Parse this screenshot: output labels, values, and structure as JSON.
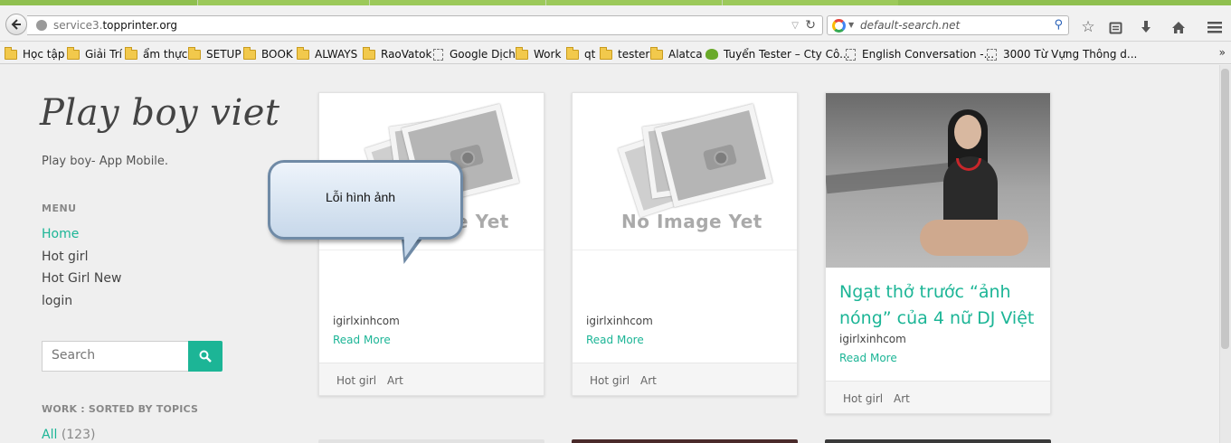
{
  "browser": {
    "url_prefix": "service3.",
    "url_domain": "topprinter.org",
    "search_placeholder": "default-search.net",
    "bookmarks": [
      {
        "label": "Học tập",
        "type": "folder"
      },
      {
        "label": "Giải Trí",
        "type": "folder"
      },
      {
        "label": "ẩm thực",
        "type": "folder"
      },
      {
        "label": "SETUP",
        "type": "folder"
      },
      {
        "label": "BOOK",
        "type": "folder"
      },
      {
        "label": "ALWAYS",
        "type": "folder"
      },
      {
        "label": "RaoVatok",
        "type": "folder"
      },
      {
        "label": "Google Dịch",
        "type": "page"
      },
      {
        "label": "Work",
        "type": "folder"
      },
      {
        "label": "qt",
        "type": "folder"
      },
      {
        "label": "tester",
        "type": "folder"
      },
      {
        "label": "Alatca",
        "type": "folder"
      },
      {
        "label": "Tuyển Tester – Cty Cô...",
        "type": "site"
      },
      {
        "label": "English Conversation -...",
        "type": "page"
      },
      {
        "label": "3000 Từ Vựng Thông d...",
        "type": "page"
      }
    ],
    "bookmarks_more": "»"
  },
  "site": {
    "title": "Play boy viet",
    "subtitle": "Play boy- App Mobile.",
    "menu_heading": "MENU",
    "menu": [
      {
        "label": "Home",
        "active": true
      },
      {
        "label": "Hot girl",
        "active": false
      },
      {
        "label": "Hot Girl New",
        "active": false
      },
      {
        "label": "login",
        "active": false
      }
    ],
    "search_placeholder": "Search",
    "topics_heading": "WORK : SORTED BY TOPICS",
    "topic_all": "All",
    "topic_all_count": "(123)",
    "accent_color": "#1cb596"
  },
  "cards": [
    {
      "image": "no-image-placeholder",
      "no_image_label": "No Image Yet",
      "author": "igirlxinhcom",
      "read_more": "Read More",
      "tags": [
        "Hot girl",
        "Art"
      ]
    },
    {
      "image": "no-image-placeholder",
      "no_image_label": "No Image Yet",
      "author": "igirlxinhcom",
      "read_more": "Read More",
      "tags": [
        "Hot girl",
        "Art"
      ]
    },
    {
      "image": "photo",
      "title": "Ngạt thở trước “ảnh nóng” của 4 nữ DJ Việt",
      "author": "igirlxinhcom",
      "read_more": "Read More",
      "tags": [
        "Hot girl",
        "Art"
      ]
    }
  ],
  "tooltip": {
    "text": "Lỗi hình ảnh"
  }
}
